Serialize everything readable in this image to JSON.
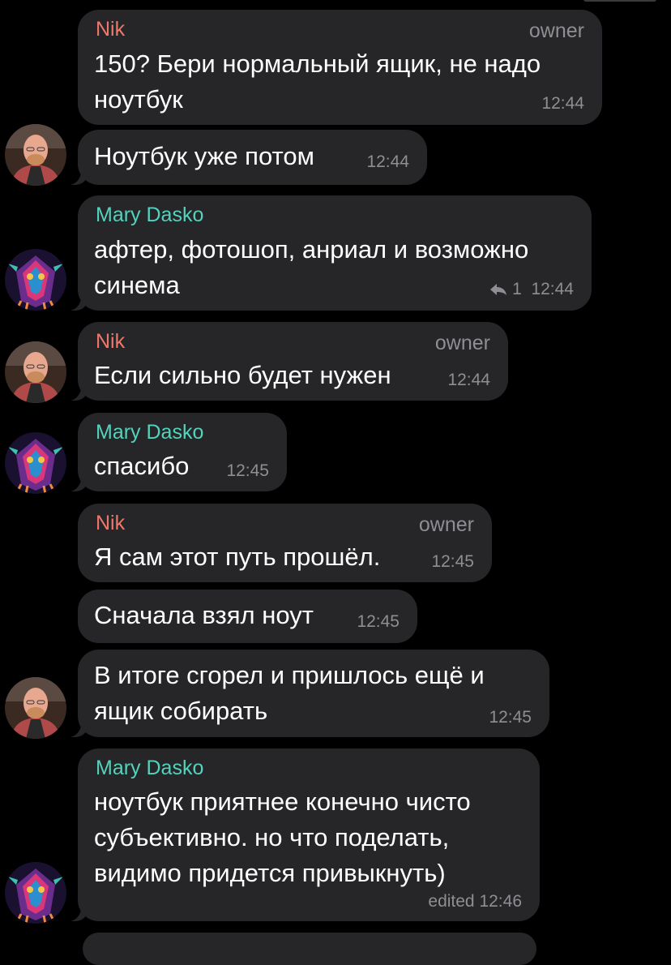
{
  "messages": [
    {
      "sender": "Nik",
      "role": "owner",
      "text": "150? Бери нормальный ящик, не надо\nноутбук",
      "time": "12:44"
    },
    {
      "text": "Ноутбук уже потом",
      "time": "12:44"
    },
    {
      "sender": "Mary Dasko",
      "text": "афтер, фотошоп, анриал и возможно\nсинема",
      "replies": "1",
      "time": "12:44"
    },
    {
      "sender": "Nik",
      "role": "owner",
      "text": "Если сильно будет нужен",
      "time": "12:44"
    },
    {
      "sender": "Mary Dasko",
      "text": "спасибо",
      "time": "12:45"
    },
    {
      "sender": "Nik",
      "role": "owner",
      "text": "Я сам этот путь прошёл.",
      "time": "12:45"
    },
    {
      "text": "Сначала взял ноут",
      "time": "12:45"
    },
    {
      "text": "В итоге сгорел и пришлось ещё и\nящик собирать",
      "time": "12:45"
    },
    {
      "sender": "Mary Dasko",
      "text": "ноутбук приятнее конечно чисто\nсубъективно. но что поделать,\nвидимо придется привыкнуть)",
      "time": "edited 12:46"
    }
  ],
  "colors": {
    "nik": "#f0776b",
    "mary": "#53d3bd",
    "bubble": "#262628",
    "background": "#000000"
  }
}
